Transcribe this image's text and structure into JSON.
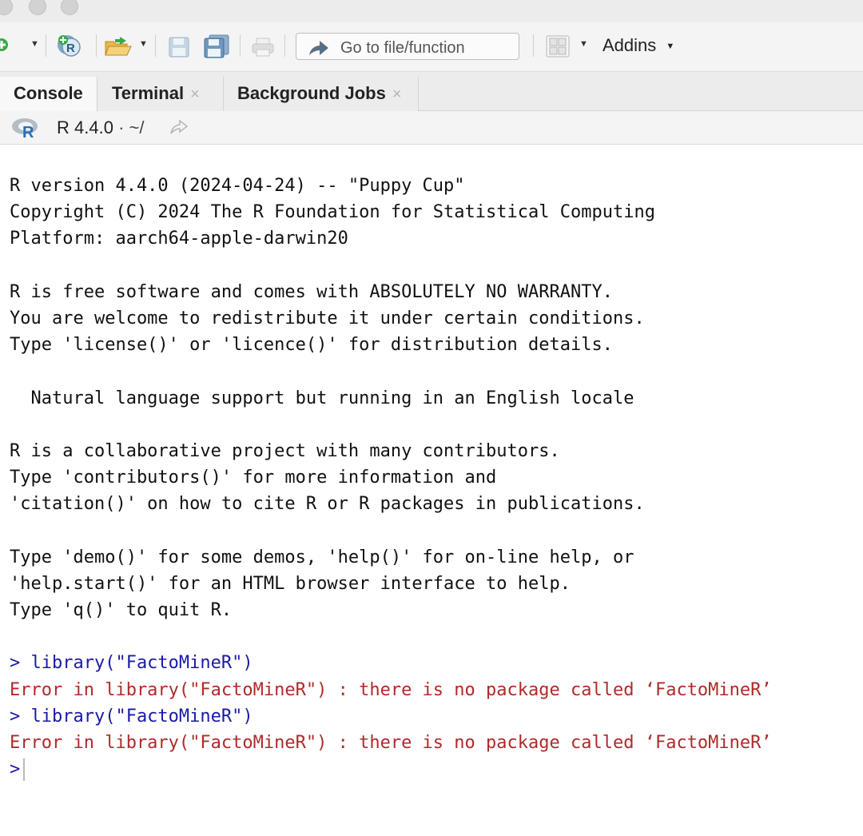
{
  "toolbar": {
    "goto_placeholder": "Go to file/function",
    "addins_label": "Addins",
    "icons": [
      "new-file-icon",
      "new-project-icon",
      "open-file-icon",
      "save-icon",
      "save-all-icon",
      "print-icon",
      "grid-layout-icon"
    ]
  },
  "tabs": [
    {
      "label": "Console",
      "active": true
    },
    {
      "label": "Terminal",
      "close": "×"
    },
    {
      "label": "Background Jobs",
      "close": "×"
    }
  ],
  "console_header": {
    "version": "R 4.4.0",
    "path": "· ~/"
  },
  "console": {
    "lines": [
      {
        "text": "R version 4.4.0 (2024-04-24) -- \"Puppy Cup\"",
        "type": "out"
      },
      {
        "text": "Copyright (C) 2024 The R Foundation for Statistical Computing",
        "type": "out"
      },
      {
        "text": "Platform: aarch64-apple-darwin20",
        "type": "out"
      },
      {
        "text": "",
        "type": "out"
      },
      {
        "text": "R is free software and comes with ABSOLUTELY NO WARRANTY.",
        "type": "out"
      },
      {
        "text": "You are welcome to redistribute it under certain conditions.",
        "type": "out"
      },
      {
        "text": "Type 'license()' or 'licence()' for distribution details.",
        "type": "out"
      },
      {
        "text": "",
        "type": "out"
      },
      {
        "text": "  Natural language support but running in an English locale",
        "type": "out"
      },
      {
        "text": "",
        "type": "out"
      },
      {
        "text": "R is a collaborative project with many contributors.",
        "type": "out"
      },
      {
        "text": "Type 'contributors()' for more information and",
        "type": "out"
      },
      {
        "text": "'citation()' on how to cite R or R packages in publications.",
        "type": "out"
      },
      {
        "text": "",
        "type": "out"
      },
      {
        "text": "Type 'demo()' for some demos, 'help()' for on-line help, or",
        "type": "out"
      },
      {
        "text": "'help.start()' for an HTML browser interface to help.",
        "type": "out"
      },
      {
        "text": "Type 'q()' to quit R.",
        "type": "out"
      },
      {
        "text": "",
        "type": "out"
      },
      {
        "text": "> library(\"FactoMineR\")",
        "type": "cmd"
      },
      {
        "text": "Error in library(\"FactoMineR\") : there is no package called ‘FactoMineR’",
        "type": "err"
      },
      {
        "text": "> library(\"FactoMineR\")",
        "type": "cmd"
      },
      {
        "text": "Error in library(\"FactoMineR\") : there is no package called ‘FactoMineR’",
        "type": "err"
      }
    ],
    "prompt": ">"
  }
}
